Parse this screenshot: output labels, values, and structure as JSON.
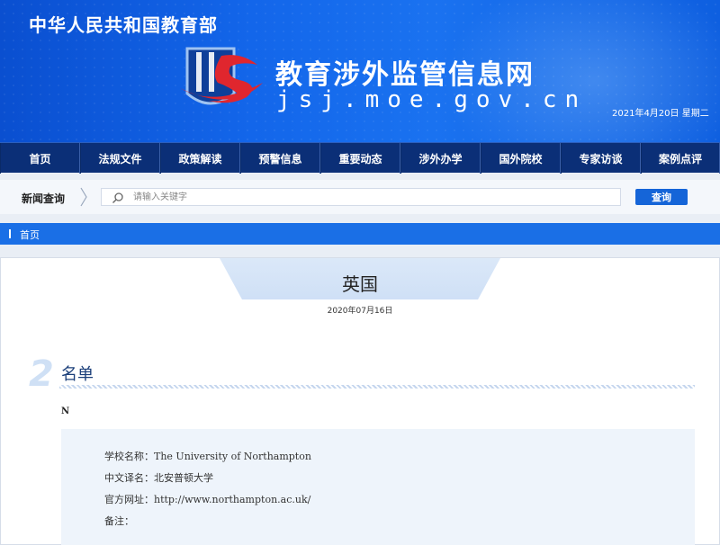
{
  "header": {
    "ministry": "中华人民共和国教育部",
    "site_title": "教育涉外监管信息网",
    "site_url": "jsj.moe.gov.cn",
    "date": "2021年4月20日  星期二",
    "colors": {
      "primary": "#1366ea",
      "nav": "#0b2f77",
      "accent_red": "#e0262e"
    }
  },
  "nav": {
    "items": [
      {
        "label": "首页"
      },
      {
        "label": "法规文件"
      },
      {
        "label": "政策解读"
      },
      {
        "label": "预警信息"
      },
      {
        "label": "重要动态"
      },
      {
        "label": "涉外办学"
      },
      {
        "label": "国外院校"
      },
      {
        "label": "专家访谈"
      },
      {
        "label": "案例点评"
      }
    ]
  },
  "search": {
    "label": "新闻查询",
    "placeholder": "请输入关键字",
    "button": "查询",
    "icon": "search-icon"
  },
  "breadcrumb": {
    "home": "首页"
  },
  "article": {
    "title": "英国",
    "date": "2020年07月16日",
    "section_number": "2",
    "section_title": "名单",
    "letter": "N",
    "info": {
      "school_name": "学校名称：The  University of Northampton",
      "chinese_name": "中文译名：北安普顿大学",
      "website": "官方网址：http://www.northampton.ac.uk/",
      "note": "备注："
    }
  }
}
